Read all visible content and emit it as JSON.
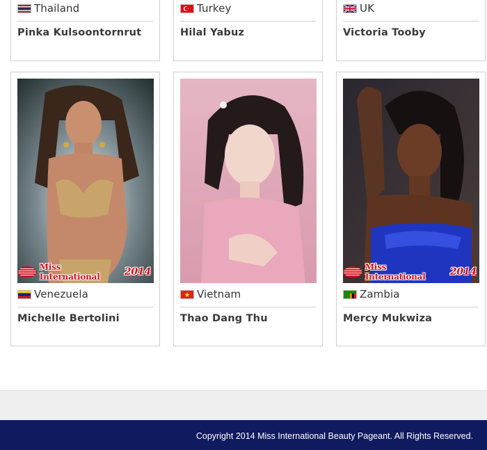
{
  "contestants_top": [
    {
      "country": "Thailand",
      "flag": "thailand-flag",
      "name": "Pinka Kulsoontornrut"
    },
    {
      "country": "Turkey",
      "flag": "turkey-flag",
      "name": "Hilal Yabuz"
    },
    {
      "country": "UK",
      "flag": "uk-flag",
      "name": "Victoria Tooby"
    }
  ],
  "contestants_bottom": [
    {
      "country": "Venezuela",
      "flag": "venezuela-flag",
      "name": "Michelle Bertolini",
      "logo_text": "Miss International",
      "logo_year": "2014"
    },
    {
      "country": "Vietnam",
      "flag": "vietnam-flag",
      "name": "Thao Dang Thu"
    },
    {
      "country": "Zambia",
      "flag": "zambia-flag",
      "name": "Mercy Mukwiza",
      "logo_text": "Miss International",
      "logo_year": "2014"
    }
  ],
  "colors": {
    "footer_bg": "#101a5e",
    "logo_red": "#d0101b",
    "card_border": "#cfcfcf"
  },
  "footer": {
    "copyright": "Copyright 2014 Miss International Beauty Pageant. All Rights Reserved."
  }
}
